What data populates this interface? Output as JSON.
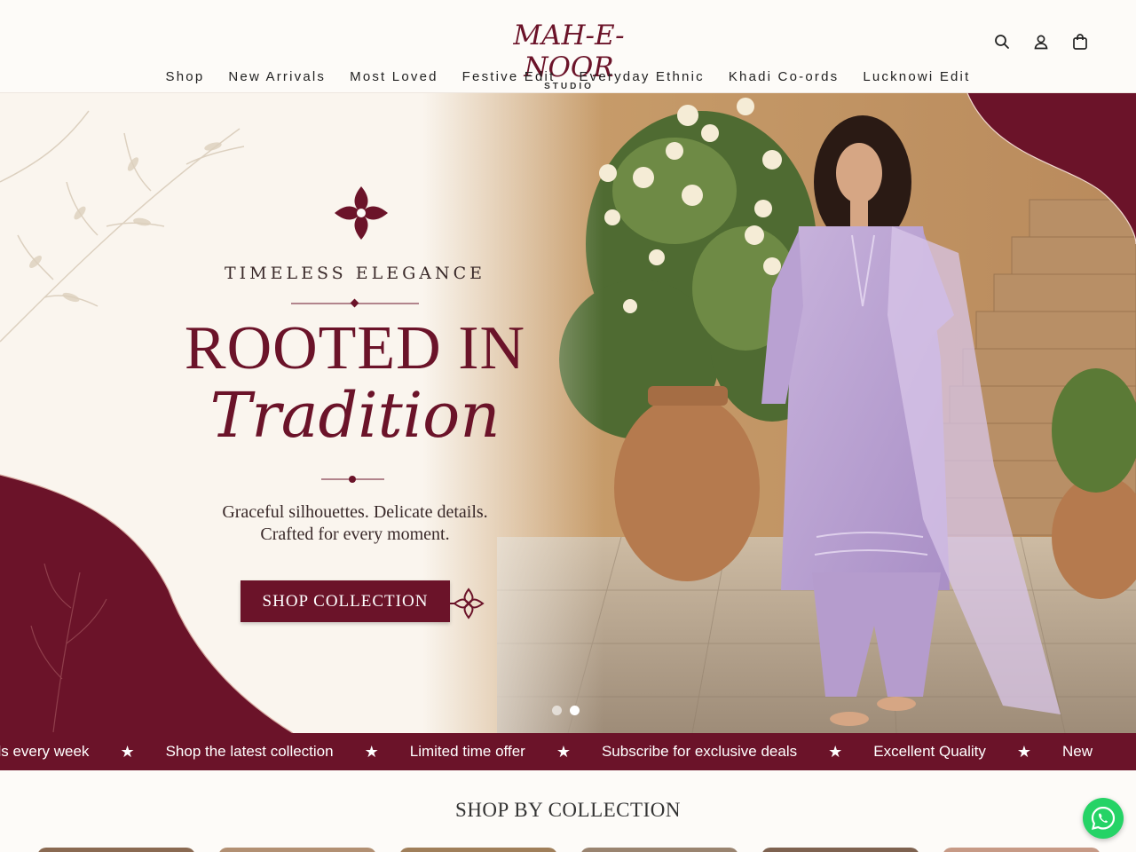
{
  "brand": {
    "name": "MAH-E-NOOR",
    "sub": "STUDIO",
    "color": "#6b1329"
  },
  "header_icons": [
    "search-icon",
    "account-icon",
    "cart-icon"
  ],
  "nav": [
    "Shop",
    "New Arrivals",
    "Most Loved",
    "Festive Edit",
    "Everyday Ethnic",
    "Khadi Co-ords",
    "Lucknowi Edit"
  ],
  "hero": {
    "eyebrow": "TIMELESS ELEGANCE",
    "headline": "ROOTED IN",
    "script": "Tradition",
    "tagline_1": "Graceful silhouettes. Delicate details.",
    "tagline_2": "Crafted for every moment.",
    "cta": "SHOP COLLECTION",
    "slides": 2,
    "active_slide": 2
  },
  "marquee": [
    "als every week",
    "Shop the latest collection",
    "Limited time offer",
    "Subscribe for exclusive deals",
    "Excellent Quality",
    "New"
  ],
  "collections": {
    "title": "SHOP BY COLLECTION"
  },
  "colors": {
    "accent": "#6b1329",
    "background": "#fdfbf8",
    "whatsapp": "#25d366"
  }
}
